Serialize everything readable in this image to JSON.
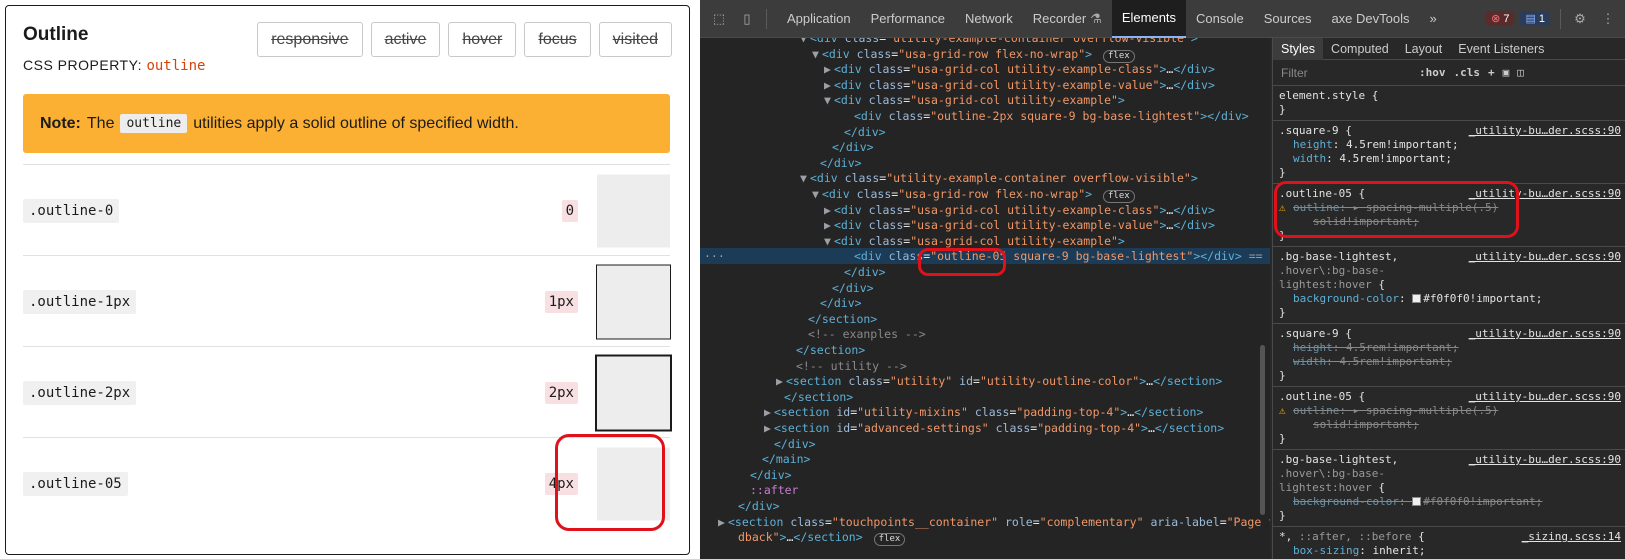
{
  "doc": {
    "title": "Outline",
    "subtitle_prefix": "CSS PROPERTY:",
    "property": "outline",
    "state_buttons": [
      "responsive",
      "active",
      "hover",
      "focus",
      "visited"
    ],
    "note": {
      "label": "Note:",
      "pre": "The",
      "code": "outline",
      "post": "utilities apply a solid outline of specified width."
    },
    "rows": [
      {
        "cls": ".outline-0",
        "val": "0"
      },
      {
        "cls": ".outline-1px",
        "val": "1px"
      },
      {
        "cls": ".outline-2px",
        "val": "2px"
      },
      {
        "cls": ".outline-05",
        "val": "4px"
      }
    ],
    "highlight_color": "#e0111b",
    "note_color": "#fbb033"
  },
  "devtools": {
    "tabs": [
      "Application",
      "Performance",
      "Network",
      "Recorder",
      "Elements",
      "Console",
      "Sources",
      "axe DevTools"
    ],
    "active_tab": "Elements",
    "more": "»",
    "errors": "7",
    "messages": "1",
    "styles_tabs": [
      "Styles",
      "Computed",
      "Layout",
      "Event Listeners"
    ],
    "filter_placeholder": "Filter",
    "hov": ":hov",
    "cls": ".cls",
    "dom_lines": [
      {
        "indent": 110,
        "tri": "▼",
        "html": "<span class='tag'>&lt;div</span> <span class='attr'>class</span>=<span class='aval'>\"utility-example-container overflow-visible\"</span><span class='tag'>&gt;</span>"
      },
      {
        "indent": 122,
        "tri": "▼",
        "html": "<span class='tag'>&lt;div</span> <span class='attr'>class</span>=<span class='aval'>\"usa-grid-row flex-no-wrap\"</span><span class='tag'>&gt;</span> <span class='flexbadge'>flex</span>"
      },
      {
        "indent": 134,
        "tri": "▶",
        "html": "<span class='tag'>&lt;div</span> <span class='attr'>class</span>=<span class='aval'>\"usa-grid-col utility-example-class\"</span><span class='tag'>&gt;</span>…<span class='tag'>&lt;/div&gt;</span>"
      },
      {
        "indent": 134,
        "tri": "▶",
        "html": "<span class='tag'>&lt;div</span> <span class='attr'>class</span>=<span class='aval'>\"usa-grid-col utility-example-value\"</span><span class='tag'>&gt;</span>…<span class='tag'>&lt;/div&gt;</span>"
      },
      {
        "indent": 134,
        "tri": "▼",
        "html": "<span class='tag'>&lt;div</span> <span class='attr'>class</span>=<span class='aval'>\"usa-grid-col utility-example\"</span><span class='tag'>&gt;</span>"
      },
      {
        "indent": 154,
        "tri": "",
        "html": "<span class='tag'>&lt;div</span> <span class='attr'>class</span>=<span class='aval'>\"outline-2px square-9 bg-base-lightest\"</span><span class='tag'>&gt;&lt;/div&gt;</span>"
      },
      {
        "indent": 144,
        "tri": "",
        "html": "<span class='tag'>&lt;/div&gt;</span>"
      },
      {
        "indent": 132,
        "tri": "",
        "html": "<span class='tag'>&lt;/div&gt;</span>"
      },
      {
        "indent": 120,
        "tri": "",
        "html": "<span class='tag'>&lt;/div&gt;</span>"
      },
      {
        "indent": 110,
        "tri": "▼",
        "html": "<span class='tag'>&lt;div</span> <span class='attr'>class</span>=<span class='aval'>\"utility-example-container overflow-visible\"</span><span class='tag'>&gt;</span>"
      },
      {
        "indent": 122,
        "tri": "▼",
        "html": "<span class='tag'>&lt;div</span> <span class='attr'>class</span>=<span class='aval'>\"usa-grid-row flex-no-wrap\"</span><span class='tag'>&gt;</span> <span class='flexbadge'>flex</span>"
      },
      {
        "indent": 134,
        "tri": "▶",
        "html": "<span class='tag'>&lt;div</span> <span class='attr'>class</span>=<span class='aval'>\"usa-grid-col utility-example-class\"</span><span class='tag'>&gt;</span>…<span class='tag'>&lt;/div&gt;</span>"
      },
      {
        "indent": 134,
        "tri": "▶",
        "html": "<span class='tag'>&lt;div</span> <span class='attr'>class</span>=<span class='aval'>\"usa-grid-col utility-example-value\"</span><span class='tag'>&gt;</span>…<span class='tag'>&lt;/div&gt;</span>"
      },
      {
        "indent": 134,
        "tri": "▼",
        "html": "<span class='tag'>&lt;div</span> <span class='attr'>class</span>=<span class='aval'>\"usa-grid-col utility-example\"</span><span class='tag'>&gt;</span>"
      },
      {
        "indent": 154,
        "tri": "",
        "sel": true,
        "html": "<span class='tag'>&lt;div</span> <span class='attr'>class</span>=<span class='aval'>\"outline-05 square-9 bg-base-lightest\"</span><span class='tag'>&gt;&lt;/div&gt;</span> <span class='dim'>== $0</span>"
      },
      {
        "indent": 144,
        "tri": "",
        "html": "<span class='tag'>&lt;/div&gt;</span>"
      },
      {
        "indent": 132,
        "tri": "",
        "html": "<span class='tag'>&lt;/div&gt;</span>"
      },
      {
        "indent": 120,
        "tri": "",
        "html": "<span class='tag'>&lt;/div&gt;</span>"
      },
      {
        "indent": 108,
        "tri": "",
        "html": "<span class='tag'>&lt;/section&gt;</span>"
      },
      {
        "indent": 108,
        "tri": "",
        "html": "<span class='cmt'>&lt;!-- exanples --&gt;</span>"
      },
      {
        "indent": 96,
        "tri": "",
        "html": "<span class='tag'>&lt;/section&gt;</span>"
      },
      {
        "indent": 96,
        "tri": "",
        "html": "<span class='cmt'>&lt;!-- utility --&gt;</span>"
      },
      {
        "indent": 86,
        "tri": "▶",
        "html": "<span class='tag'>&lt;section</span> <span class='attr'>class</span>=<span class='aval'>\"utility\"</span> <span class='attr'>id</span>=<span class='aval'>\"utility-outline-color\"</span><span class='tag'>&gt;</span>…<span class='tag'>&lt;/section&gt;</span>"
      },
      {
        "indent": 84,
        "tri": "",
        "html": "<span class='tag'>&lt;/section&gt;</span>"
      },
      {
        "indent": 74,
        "tri": "▶",
        "html": "<span class='tag'>&lt;section</span> <span class='attr'>id</span>=<span class='aval'>\"utility-mixins\"</span> <span class='attr'>class</span>=<span class='aval'>\"padding-top-4\"</span><span class='tag'>&gt;</span>…<span class='tag'>&lt;/section&gt;</span>"
      },
      {
        "indent": 74,
        "tri": "▶",
        "html": "<span class='tag'>&lt;section</span> <span class='attr'>id</span>=<span class='aval'>\"advanced-settings\"</span> <span class='attr'>class</span>=<span class='aval'>\"padding-top-4\"</span><span class='tag'>&gt;</span>…<span class='tag'>&lt;/section&gt;</span>"
      },
      {
        "indent": 74,
        "tri": "",
        "html": "<span class='tag'>&lt;/div&gt;</span>"
      },
      {
        "indent": 62,
        "tri": "",
        "html": "<span class='tag'>&lt;/main&gt;</span>"
      },
      {
        "indent": 50,
        "tri": "",
        "html": "<span class='tag'>&lt;/div&gt;</span>"
      },
      {
        "indent": 50,
        "tri": "",
        "html": "<span class='pseudo'>::after</span>"
      },
      {
        "indent": 38,
        "tri": "",
        "html": "<span class='tag'>&lt;/div&gt;</span>"
      },
      {
        "indent": 28,
        "tri": "▶",
        "html": "<span class='tag'>&lt;section</span> <span class='attr'>class</span>=<span class='aval'>\"touchpoints__container\"</span> <span class='attr'>role</span>=<span class='aval'>\"complementary\"</span> <span class='attr'>aria-label</span>=<span class='aval'>\"Page fee</span>"
      },
      {
        "indent": 38,
        "tri": "",
        "html": "<span class='aval'>dback\"</span><span class='tag'>&gt;</span>…<span class='tag'>&lt;/section&gt;</span> <span class='flexbadge'>flex</span>"
      }
    ],
    "rules": [
      {
        "html": "<span class='sel-name'>element.style</span> {<br>}"
      },
      {
        "html": "<span class='sel-name'>.square-9</span> {<span class='src'>_utility-bu…der.scss:90</span><br><div class='decl'><span class='pn'>height</span>: <span class='pv'>4.5rem!important;</span></div><div class='decl'><span class='pn'>width</span>: <span class='pv'>4.5rem!important;</span></div>}"
      },
      {
        "html": "<span class='sel-name'>.outline-05</span> {<span class='src'>_utility-bu…der.scss:90</span><br><div class='decl strike'><span class='warn'>⚠</span><span class='pn'>outline</span>: ▸ spacing-multiple(.5)</div><div class='decl strike' style='padding-left:34px'>solid!important;</div>}"
      },
      {
        "html": "<span class='sel-name'>.bg-base-lightest</span>,<span class='src'>_utility-bu…der.scss:90</span><br><span class='dim'>.hover\\:bg-base-</span><br><span class='dim'>lightest:hover</span> {<div class='decl'><span class='pn'>background-color</span>: <span class='swatch'></span><span class='pv'>#f0f0f0!important;</span></div>}"
      },
      {
        "html": "<span class='sel-name'>.square-9</span> {<span class='src'>_utility-bu…der.scss:90</span><br><div class='decl strike'><span class='pn'>height</span>: 4.5rem!important;</div><div class='decl strike'><span class='pn'>width</span>: 4.5rem!important;</div>}"
      },
      {
        "html": "<span class='sel-name'>.outline-05</span> {<span class='src'>_utility-bu…der.scss:90</span><br><div class='decl strike'><span class='warn'>⚠</span><span class='pn'>outline</span>: ▸ spacing-multiple(.5)</div><div class='decl strike' style='padding-left:34px'>solid!important;</div>}"
      },
      {
        "html": "<span class='sel-name'>.bg-base-lightest</span>,<span class='src'>_utility-bu…der.scss:90</span><br><span class='dim'>.hover\\:bg-base-</span><br><span class='dim'>lightest:hover</span> {<div class='decl strike'><span class='pn'>background-color</span>: <span class='swatch'></span>#f0f0f0!important;</div>}"
      },
      {
        "html": "<span class='sel-name'>*, <span class='dim'>::after, ::before</span></span> {<span class='src'>_sizing.scss:14</span><br><div class='decl'><span class='pn'>box-sizing</span>: <span class='pv'>inherit;</span></div>"
      }
    ]
  }
}
